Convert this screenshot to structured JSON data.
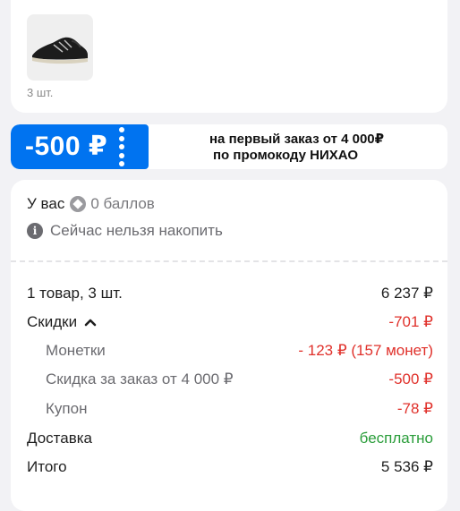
{
  "product": {
    "quantity_label": "3 шт."
  },
  "promo": {
    "amount": "-500 ₽",
    "line1": "на первый заказ от 4 000₽",
    "line2": "по промокоду НИХАО"
  },
  "bonus": {
    "prefix": "У вас",
    "value": "0 баллов",
    "info": "Сейчас нельзя накопить"
  },
  "summary": {
    "items_label": "1 товар, 3 шт.",
    "items_value": "6 237 ₽",
    "discounts_label": "Скидки",
    "discounts_value": "-701 ₽",
    "coins_label": "Монетки",
    "coins_value": "- 123 ₽ (157 монет)",
    "order_discount_label": "Скидка за заказ от 4 000 ₽",
    "order_discount_value": "-500 ₽",
    "coupon_label": "Купон",
    "coupon_value": "-78 ₽",
    "delivery_label": "Доставка",
    "delivery_value": "бесплатно",
    "total_label": "Итого",
    "total_value": "5 536 ₽"
  },
  "colors": {
    "accent_blue": "#0073f0",
    "discount_red": "#e0312b",
    "free_green": "#2a9d3a"
  },
  "icons": [
    "sneaker-image",
    "coin-icon",
    "info-icon",
    "chevron-up-icon"
  ]
}
